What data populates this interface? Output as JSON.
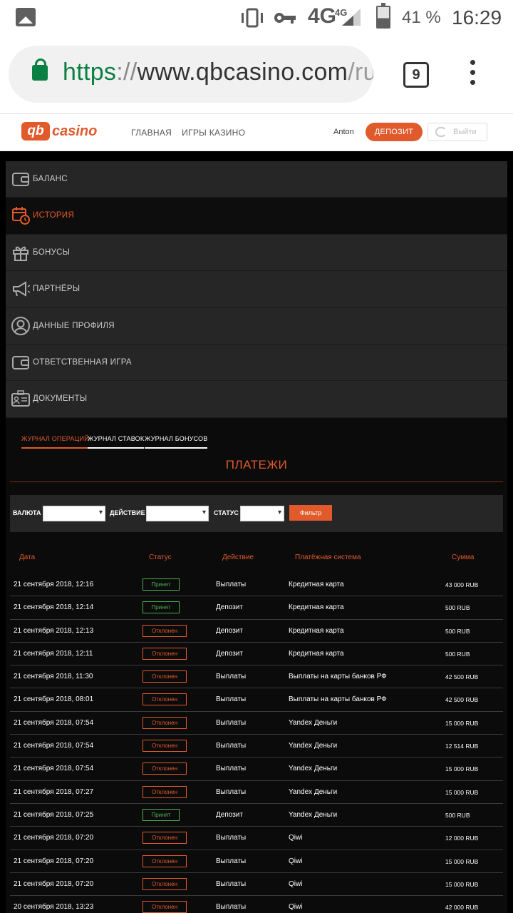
{
  "status_bar": {
    "network": "4G",
    "network_small": "4G",
    "battery": "41 %",
    "time": "16:29"
  },
  "browser": {
    "url_scheme": "https",
    "url_sep": "://",
    "url_host": "www.qbcasino.com",
    "url_rest": "/ru",
    "tabs_count": "9"
  },
  "site": {
    "logo_mark": "qb",
    "logo_text": "casino",
    "nav": [
      "ГЛАВНАЯ",
      "ИГРЫ КАЗИНО"
    ],
    "user": "Anton",
    "deposit": "ДЕПОЗИТ",
    "logout": "Выйти"
  },
  "sidebar": [
    {
      "label": "БАЛАНС",
      "icon": "wallet-icon"
    },
    {
      "label": "ИСТОРИЯ",
      "icon": "calendar-clock-icon",
      "active": true
    },
    {
      "label": "БОНУСЫ",
      "icon": "gift-icon"
    },
    {
      "label": "ПАРТНЁРЫ",
      "icon": "megaphone-icon"
    },
    {
      "label": "ДАННЫЕ ПРОФИЛЯ",
      "icon": "user-icon"
    },
    {
      "label": "ОТВЕТСТВЕННАЯ ИГРА",
      "icon": "wallet-icon"
    },
    {
      "label": "ДОКУМЕНТЫ",
      "icon": "id-card-icon"
    }
  ],
  "subtabs": [
    "ЖУРНАЛ ОПЕРАЦИЙ",
    "ЖУРНАЛ СТАВОК",
    "ЖУРНАЛ БОНУСОВ"
  ],
  "section_title": "ПЛАТЕЖИ",
  "filter": {
    "currency": "ВАЛЮТА",
    "action": "ДЕЙСТВИЕ",
    "status": "СТАТУС",
    "button": "Фильтр"
  },
  "table": {
    "headers": [
      "Дата",
      "Статус",
      "Действие",
      "Платёжная система",
      "Сумма"
    ],
    "rows": [
      {
        "date": "21 сентября 2018, 12:16",
        "status": "Принят",
        "ok": true,
        "action": "Выплаты",
        "system": "Кредитная карта",
        "amount": "43 000 RUB"
      },
      {
        "date": "21 сентября 2018, 12:14",
        "status": "Принят",
        "ok": true,
        "action": "Депозит",
        "system": "Кредитная карта",
        "amount": "500 RUB"
      },
      {
        "date": "21 сентября 2018, 12:13",
        "status": "Отклонен",
        "ok": false,
        "action": "Депозит",
        "system": "Кредитная карта",
        "amount": "500 RUB"
      },
      {
        "date": "21 сентября 2018, 12:11",
        "status": "Отклонен",
        "ok": false,
        "action": "Депозит",
        "system": "Кредитная карта",
        "amount": "500 RUB"
      },
      {
        "date": "21 сентября 2018, 11:30",
        "status": "Отклонен",
        "ok": false,
        "action": "Выплаты",
        "system": "Выплаты на карты банков РФ",
        "amount": "42 500 RUB"
      },
      {
        "date": "21 сентября 2018, 08:01",
        "status": "Отклонен",
        "ok": false,
        "action": "Выплаты",
        "system": "Выплаты на карты банков РФ",
        "amount": "42 500 RUB"
      },
      {
        "date": "21 сентября 2018, 07:54",
        "status": "Отклонен",
        "ok": false,
        "action": "Выплаты",
        "system": "Yandex Деньги",
        "amount": "15 000 RUB"
      },
      {
        "date": "21 сентября 2018, 07:54",
        "status": "Отклонен",
        "ok": false,
        "action": "Выплаты",
        "system": "Yandex Деньги",
        "amount": "12 514 RUB"
      },
      {
        "date": "21 сентября 2018, 07:54",
        "status": "Отклонен",
        "ok": false,
        "action": "Выплаты",
        "system": "Yandex Деньги",
        "amount": "15 000 RUB"
      },
      {
        "date": "21 сентября 2018, 07:27",
        "status": "Отклонен",
        "ok": false,
        "action": "Выплаты",
        "system": "Yandex Деньги",
        "amount": "15 000 RUB"
      },
      {
        "date": "21 сентября 2018, 07:25",
        "status": "Принят",
        "ok": true,
        "action": "Депозит",
        "system": "Yandex Деньги",
        "amount": "500 RUB"
      },
      {
        "date": "21 сентября 2018, 07:20",
        "status": "Отклонен",
        "ok": false,
        "action": "Выплаты",
        "system": "Qiwi",
        "amount": "12 000 RUB"
      },
      {
        "date": "21 сентября 2018, 07:20",
        "status": "Отклонен",
        "ok": false,
        "action": "Выплаты",
        "system": "Qiwi",
        "amount": "15 000 RUB"
      },
      {
        "date": "21 сентября 2018, 07:20",
        "status": "Отклонен",
        "ok": false,
        "action": "Выплаты",
        "system": "Qiwi",
        "amount": "15 000 RUB"
      },
      {
        "date": "20 сентября 2018, 13:23",
        "status": "Отклонен",
        "ok": false,
        "action": "Выплаты",
        "system": "Qiwi",
        "amount": "42 000 RUB"
      }
    ]
  },
  "colors": {
    "accent": "#e05a2b",
    "ok": "#4caf50",
    "secure": "#0b8043"
  }
}
